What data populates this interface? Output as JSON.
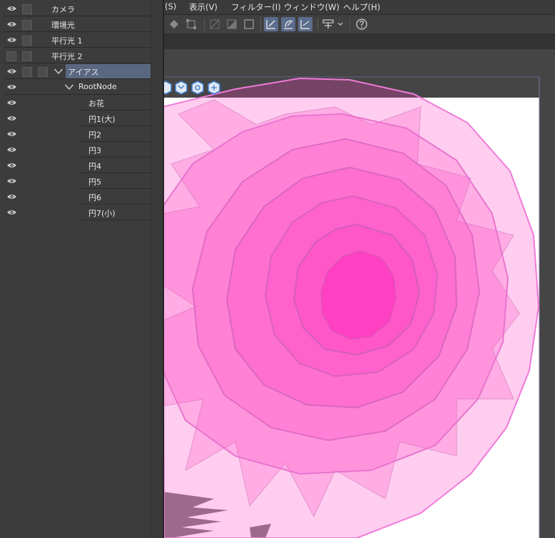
{
  "menu": {
    "items": [
      "(S)",
      "表示(V)",
      "フィルター(I)",
      "ウィンドウ(W)",
      "ヘルプ(H)"
    ]
  },
  "toolbar": {
    "icons": [
      "fill-selection-icon",
      "transform-icon",
      "hide-selection-icon",
      "invert-selection-icon",
      "selection-border-icon",
      "ruler-snap-icon",
      "special-ruler-snap-icon",
      "grid-snap-icon",
      "canvas-flip-icon",
      "help-icon"
    ]
  },
  "layers": [
    {
      "name": "カメラ",
      "visible": true,
      "indent": 0
    },
    {
      "name": "環境光",
      "visible": true,
      "indent": 0
    },
    {
      "name": "平行光 1",
      "visible": true,
      "indent": 0
    },
    {
      "name": "平行光 2",
      "visible": false,
      "indent": 0
    },
    {
      "name": "アイアス",
      "visible": true,
      "indent": 0,
      "selected": true,
      "expanded": true
    },
    {
      "name": "RootNode",
      "visible": true,
      "indent": 1,
      "expanded": true
    },
    {
      "name": "お花",
      "visible": true,
      "indent": 2
    },
    {
      "name": "円1(大)",
      "visible": true,
      "indent": 2
    },
    {
      "name": "円2",
      "visible": true,
      "indent": 2
    },
    {
      "name": "円3",
      "visible": true,
      "indent": 2
    },
    {
      "name": "円4",
      "visible": true,
      "indent": 2
    },
    {
      "name": "円5",
      "visible": true,
      "indent": 2
    },
    {
      "name": "円6",
      "visible": true,
      "indent": 2
    },
    {
      "name": "円7(小)",
      "visible": true,
      "indent": 2
    }
  ],
  "canvas": {
    "model_color": "#ff2fbf",
    "paper_color": "#ffffff",
    "workspace_color": "#454545",
    "object_launcher_icons": [
      "camera-angle-icon",
      "move-camera-icon",
      "rotate-object-icon",
      "pan-object-icon"
    ]
  }
}
